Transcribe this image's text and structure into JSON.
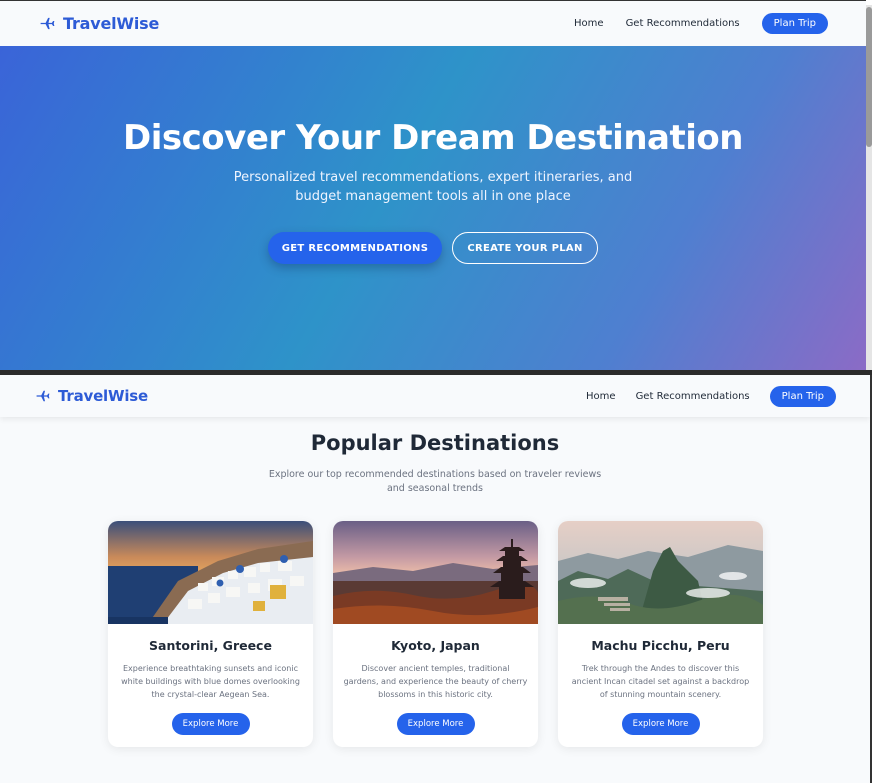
{
  "brand": {
    "name": "TravelWise",
    "icon": "plane-icon",
    "color": "#2d5bd6"
  },
  "nav": {
    "items": [
      {
        "label": "Home"
      },
      {
        "label": "Get Recommendations"
      }
    ],
    "cta": "Plan Trip"
  },
  "hero": {
    "title": "Discover Your Dream Destination",
    "subtitle": "Personalized travel recommendations, expert itineraries, and budget management tools all in one place",
    "primary_button": "GET RECOMMENDATIONS",
    "secondary_button": "CREATE YOUR PLAN"
  },
  "destinations": {
    "title": "Popular Destinations",
    "subtitle": "Explore our top recommended destinations based on traveler reviews and seasonal trends",
    "cards": [
      {
        "title": "Santorini, Greece",
        "description": "Experience breathtaking sunsets and iconic white buildings with blue domes overlooking the crystal-clear Aegean Sea.",
        "button": "Explore More"
      },
      {
        "title": "Kyoto, Japan",
        "description": "Discover ancient temples, traditional gardens, and experience the beauty of cherry blossoms in this historic city.",
        "button": "Explore More"
      },
      {
        "title": "Machu Picchu, Peru",
        "description": "Trek through the Andes to discover this ancient Incan citadel set against a backdrop of stunning mountain scenery.",
        "button": "Explore More"
      }
    ]
  },
  "colors": {
    "accent": "#2563eb",
    "page_bg": "#f8fafc"
  }
}
